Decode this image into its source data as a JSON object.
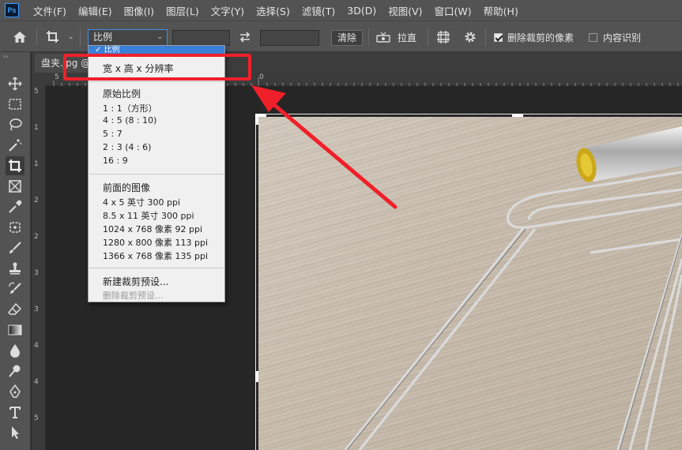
{
  "app": {
    "logo_text": "Ps"
  },
  "menu": {
    "items": [
      "文件(F)",
      "编辑(E)",
      "图像(I)",
      "图层(L)",
      "文字(Y)",
      "选择(S)",
      "滤镜(T)",
      "3D(D)",
      "视图(V)",
      "窗口(W)",
      "帮助(H)"
    ]
  },
  "options": {
    "ratio_select": "比例",
    "clear_button": "清除",
    "straighten_label": "拉直",
    "delete_cropped_label": "删除裁剪的像素",
    "delete_cropped_checked": true,
    "content_aware_label": "内容识别",
    "content_aware_checked": false
  },
  "document": {
    "tab_title": "盘夹.jpg @"
  },
  "rulers": {
    "top_labels": [
      "5",
      "0"
    ],
    "left_labels": [
      "5",
      "1",
      "1",
      "2",
      "2",
      "3",
      "3",
      "4",
      "4",
      "5"
    ]
  },
  "dropdown": {
    "selected": "比例",
    "item_highlighted": "宽 x 高 x 分辨率",
    "group1": [
      "原始比例",
      "1 : 1（方形）",
      "4 : 5 (8 : 10)",
      "5 : 7",
      "2 : 3 (4 : 6)",
      "16 : 9"
    ],
    "group2": [
      "前面的图像",
      "4 x 5 英寸 300 ppi",
      "8.5 x 11 英寸 300 ppi",
      "1024 x 768 像素 92 ppi",
      "1280 x 800 像素 113 ppi",
      "1366 x 768 像素 135 ppi"
    ],
    "group3": [
      "新建裁剪预设...",
      "删除裁剪预设..."
    ]
  },
  "colors": {
    "accent": "#3a7fd8",
    "annotation": "#f0202a"
  },
  "icons": {
    "toolbar": [
      "move-icon",
      "marquee-icon",
      "lasso-icon",
      "magic-wand-icon",
      "crop-icon",
      "frame-icon",
      "eyedropper-icon",
      "healing-icon",
      "brush-icon",
      "stamp-icon",
      "history-brush-icon",
      "eraser-icon",
      "gradient-icon",
      "blur-icon",
      "dodge-icon",
      "pen-icon",
      "type-icon",
      "path-select-icon"
    ]
  }
}
